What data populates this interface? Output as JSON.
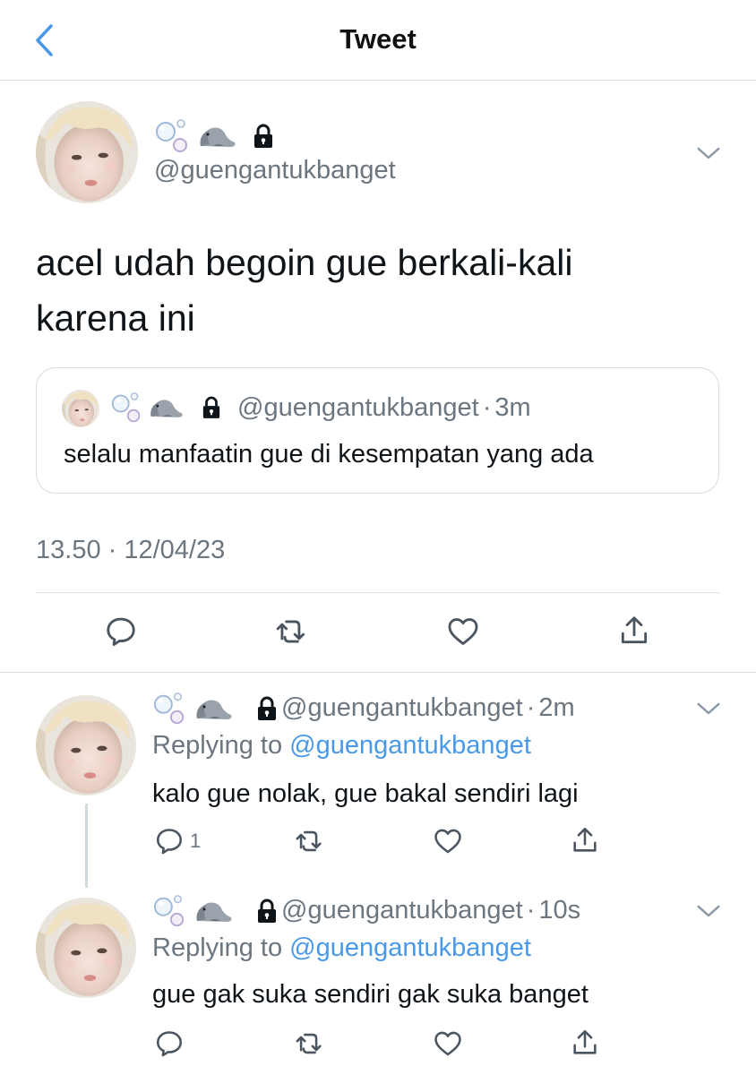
{
  "header": {
    "title": "Tweet",
    "back_icon": "chevron-left-icon"
  },
  "main_tweet": {
    "display_name_emojis": [
      "bubbles-emoji",
      "seal-emoji"
    ],
    "locked": true,
    "handle": "@guengantukbanget",
    "text_line1": "acel udah begoin gue berkali-kali",
    "text_line2": "karena ini",
    "quote": {
      "handle": "@guengantukbanget",
      "sep": "·",
      "time": "3m",
      "text": "selalu manfaatin gue di kesempatan yang ada"
    },
    "timestamp": "13.50 · 12/04/23",
    "actions": [
      "reply-icon",
      "retweet-icon",
      "like-icon",
      "share-icon"
    ]
  },
  "replies": [
    {
      "handle": "@guengantukbanget",
      "sep": "·",
      "time": "2m",
      "replying_prefix": "Replying to ",
      "replying_to": "@guengantukbanget",
      "text": "kalo gue nolak, gue bakal sendiri lagi",
      "reply_count": "1"
    },
    {
      "handle": "@guengantukbanget",
      "sep": "·",
      "time": "10s",
      "replying_prefix": "Replying to ",
      "replying_to": "@guengantukbanget",
      "text": "gue gak suka sendiri gak suka banget",
      "reply_count": ""
    }
  ],
  "colors": {
    "accent": "#4a99e9",
    "muted": "#6b7680",
    "border": "#dfe3e6"
  }
}
